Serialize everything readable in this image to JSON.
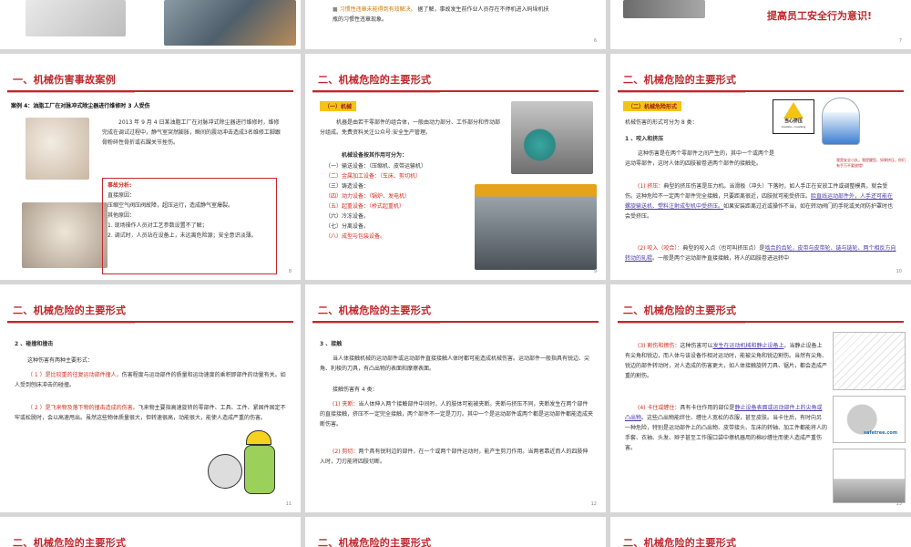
{
  "slides": {
    "top_mid": {
      "bullet": "习惯性违章未能得到有效解决。",
      "line1_rest": "据了解，事故发生前作业人员存在不停机进入码垛机扶",
      "line2": "瓶的习惯性违章现象。",
      "page": "6"
    },
    "top_right": {
      "slogan": "提高员工安全行为意识!",
      "page": "7"
    },
    "s8": {
      "title": "一、机械伤害事故案例",
      "case_title": "案例 4：油脂工厂在对脉冲式除尘器进行维修时 3 人受伤",
      "body": "2013 年 9 月 4 日某油脂工厂在对脉冲式除尘器进行维修时，维修完成在调试过程中，静气室突然膨胀，瞬间的震动冲击造成3名维修工脚跟骨粉碎性骨折或右踝关节挫伤。",
      "analysis_title": "事故分析:",
      "analysis": [
        "直接原因：",
        "压缩空气阀压阀故障，超压运行，造成静气室爆裂。",
        "其他原因：",
        "1. 现场操作人员对工艺参数设置不了解；",
        "2. 调试时，人员站在设备上，未远离危险源；安全意识淡薄。"
      ],
      "page": "8"
    },
    "s9": {
      "title": "二、机械危险的主要形式",
      "tag": "（一）机械",
      "intro": "机器是由若干零部件的组合体，一般由动力部分、工作部分和传动部分组成。免费资料关注公众号:安全生产管理。",
      "subhead": "机械设备按其作用可分为：",
      "items": [
        "（一）输送设备：（压缩机、皮带运输机）",
        "（二）金属加工设备：（车床、剪切机）",
        "（三）铸造设备：",
        "（四）动力设备：（锅炉、发电机）",
        "（五）起重设备：（桥式起重机）",
        "（六）冷冻设备。",
        "（七）分离设备。",
        "（八）成型与包装设备。"
      ],
      "page": "9"
    },
    "s10": {
      "title": "二、机械危险的主要形式",
      "tag": "（二）机械危险形式",
      "intro": "机械伤害的形式可分为 8 类：",
      "head1": "1 、咬入和挤压",
      "p1": "这种伤害是在两个零部件之间产生的，其中一个或两个是运动零部件，这时人体的四肢被卷进两个部件的接触处。",
      "p2a": "(1) 挤压：",
      "p2b": "典型的挤压伤害是压力机。当滑板（冲头）下落时，如人手正在安放工件或调整模具，就会受伤。这种危险不一定两个部件完全接触，只要距离很近，四肢就可能受挤压。",
      "p2c": "脸直线运动部件外，人手还可能在螺旋输送机、塑料注射成型机中受挤压。",
      "p2d": "如果安装距离过近或操作不当，如在转动阀门的手轮或关闭防护罩时也会受挤压。",
      "p3a": "(2) 咬入（咬合）：",
      "p3b": "典型的咬入点（也可叫挤压点）是",
      "p3c": "啮合的齿轮，皮带与皮带轮、链与链轮、两个相反方向转动的轧辊",
      "p3d": "。一般是两个运动部件直接接触，将人的四肢卷进运转中",
      "sign": "当心挤压",
      "sign_en": "Caution, crushing",
      "bubble": "我是安全小队，我提醒您，如果挤压，你们有手万不要放错!",
      "page": "10"
    },
    "s11": {
      "title": "二、机械危险的主要形式",
      "head": "2 、碰撞和撞击",
      "p1": "这种伤害有两种主要形式：",
      "p2a": "（ 1 ）是比较重的往复运动部件撞人，",
      "p2b": "伤害程度与运动部件的质量和运动速度的乘积即部件的动量有关。如人受到刨床冲击的碰撞。",
      "p3a": "（ 2 ）是飞来物及落下物的撞击造成的伤害。",
      "p3b": "飞来物主要指高速旋转的零部件、工具、工件、紧固件固定不牢或松脱时，会以高速甩出。虽然这些物体质量很大，但转速很高，动能很大，能使人造成严重的伤害。",
      "page": "11"
    },
    "s12": {
      "title": "二、机械危险的主要形式",
      "head": "3 、接触",
      "p1": "当人体接触机械的运动部件或运动部件直接接触人体时都可能造成机械伤害。运动部件一般指具有锐边、尖角、利棱的刀具，有凸出物的表面和摩擦表面。",
      "p2": "接触伤害有 4 类：",
      "p3a": "(1) 夹断：",
      "p3b": "当人体伸入两个接触部件中间时，人的肢体可能被夹断。夹断与挤压不同，夹断发生在两个部件的直接接触，挤压不一定完全接触，两个部件不一定是刀刃。其中一个是运动部件或两个都是运动部件都能造成夹断伤害。",
      "p4a": "(2) 剪切：",
      "p4b": "两个具有锐利边的部件，在一个或两个部件运动时，能产生剪刀作用。当两者靠近而人的四肢伸入时，刀刃能将四肢切断。",
      "page": "12"
    },
    "s13": {
      "title": "二、机械危险的主要形式",
      "p1a": "(3) 割伤和擦伤：",
      "p1b": "这种伤害可以",
      "p1c": "发生在运动机械和静止设备上",
      "p1d": "。当静止设备上有尖角和锐边，而人体与该设备作相对运动时，能被尖角和锐边割伤。当然有尖角、锐边的部件转动时，对人造成的伤害更大，如人体接触旋转刀具、锯片，都会造成严重的割伤。",
      "p2a": "(4) 卡住或缠住：",
      "p2b": "具有卡住作用的部位是",
      "p2c": "静止设备表面或运动部件上的尖角或凸出物",
      "p2d": "。这些凸出物能绊住、缠住人宽松的衣服，甚至皮肤。当卡住后，有时向另一种危险，特别是运动部件上的凸出物、皮带接头、车床的转轴、加工件都能将人的手套、衣袖、头发、辫子甚至工作服口袋中擦机器用的棉纱缠住而使人造成严重伤害。",
      "watermark": "safetree.com",
      "page": "13"
    },
    "bottom": {
      "t1": "二、机械危险的主要形式",
      "t2": "二、机械危险的主要形式",
      "t3": "二、机械危险的主要形式"
    }
  }
}
